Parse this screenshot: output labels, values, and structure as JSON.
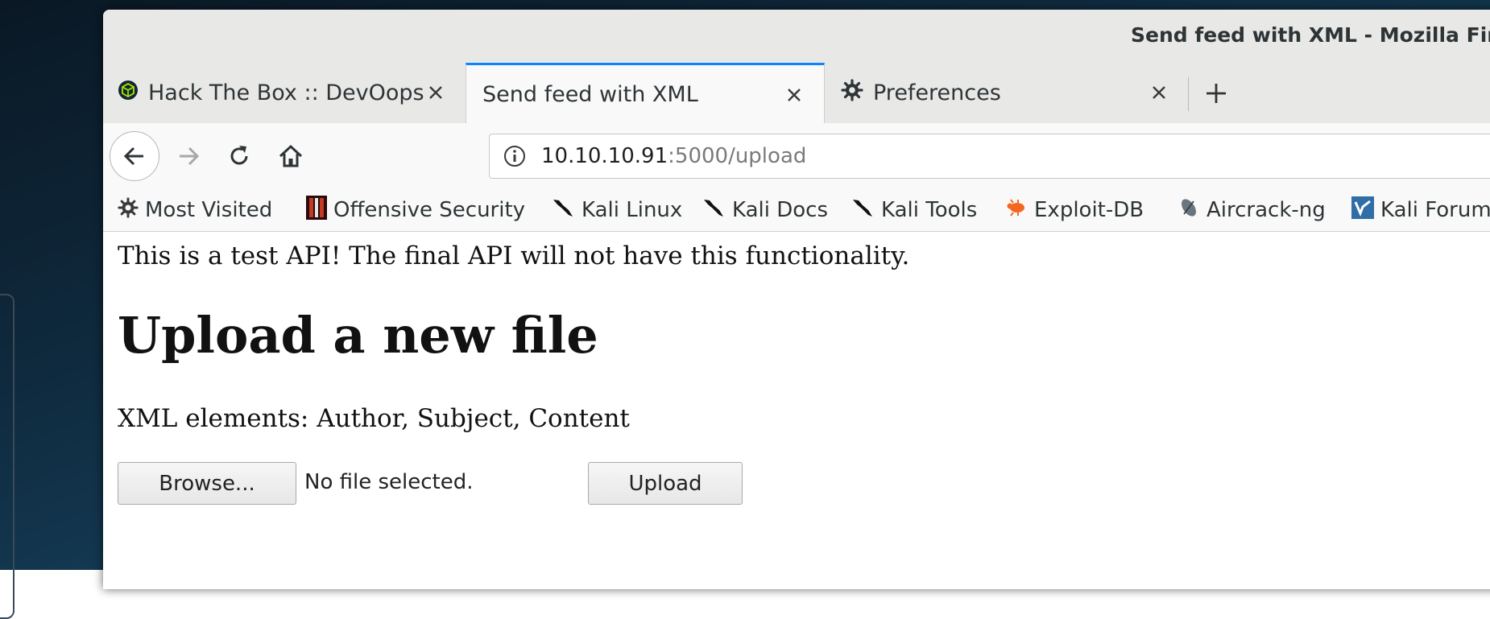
{
  "window": {
    "title": "Send feed with XML - Mozilla Firefox"
  },
  "tabs": [
    {
      "label": "Hack The Box :: DevOops",
      "icon": "htb-cube-icon",
      "active": false
    },
    {
      "label": "Send feed with XML",
      "icon": "none",
      "active": true
    },
    {
      "label": "Preferences",
      "icon": "gear-icon",
      "active": false
    }
  ],
  "navbar": {
    "url_host": "10.10.10.91",
    "url_rest": ":5000/upload"
  },
  "bookmarks": [
    {
      "label": "Most Visited",
      "icon": "gear-icon"
    },
    {
      "label": "Offensive Security",
      "icon": "offsec-icon"
    },
    {
      "label": "Kali Linux",
      "icon": "kali-dragon-icon"
    },
    {
      "label": "Kali Docs",
      "icon": "kali-dragon-icon"
    },
    {
      "label": "Kali Tools",
      "icon": "kali-dragon-icon"
    },
    {
      "label": "Exploit-DB",
      "icon": "exploitdb-bug-icon"
    },
    {
      "label": "Aircrack-ng",
      "icon": "aircrack-icon"
    },
    {
      "label": "Kali Forums",
      "icon": "kali-forums-icon"
    }
  ],
  "page": {
    "note": "This is a test API! The final API will not have this functionality.",
    "heading": "Upload a new file",
    "elements_text": "XML elements: Author, Subject, Content",
    "browse_label": "Browse...",
    "file_status": "No file selected.",
    "upload_label": "Upload"
  },
  "colors": {
    "active_tab_accent": "#0a84ff",
    "desktop_background": "#143c56"
  }
}
